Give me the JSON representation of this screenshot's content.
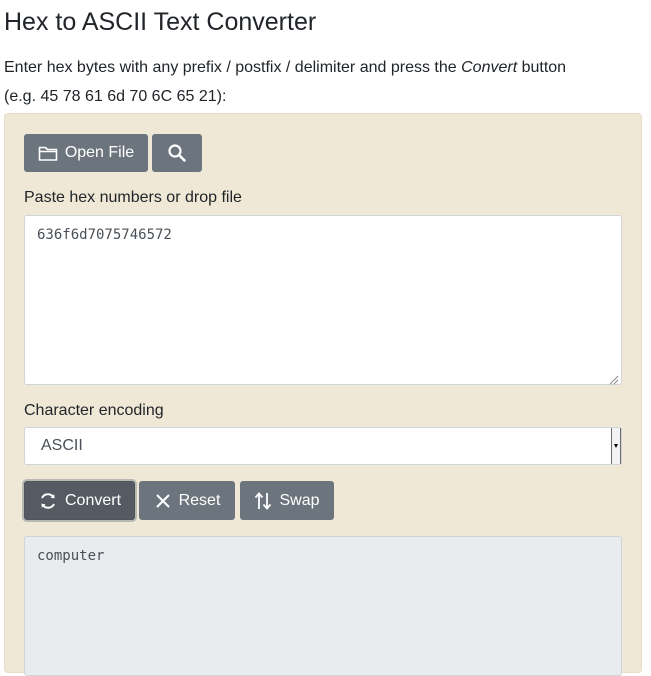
{
  "page": {
    "title": "Hex to ASCII Text Converter",
    "intro_before": "Enter hex bytes with any prefix / postfix / delimiter and press the ",
    "intro_emph": "Convert",
    "intro_after": " button",
    "example": "(e.g. 45 78 61 6d 70 6C 65 21):"
  },
  "toolbar": {
    "open_file_label": "Open File",
    "open_file_icon": "folder-icon",
    "search_icon": "search-icon"
  },
  "input": {
    "label": "Paste hex numbers or drop file",
    "value": "636f6d7075746572"
  },
  "encoding": {
    "label": "Character encoding",
    "selected": "ASCII"
  },
  "actions": {
    "convert_label": "Convert",
    "convert_icon": "refresh-icon",
    "reset_label": "Reset",
    "reset_icon": "close-icon",
    "swap_label": "Swap",
    "swap_icon": "swap-arrows-icon"
  },
  "output": {
    "value": "computer"
  },
  "colors": {
    "panel_bg": "#efe8d6",
    "button_bg": "#6c757d",
    "button_active_bg": "#545b62",
    "output_bg": "#e9ecef"
  }
}
